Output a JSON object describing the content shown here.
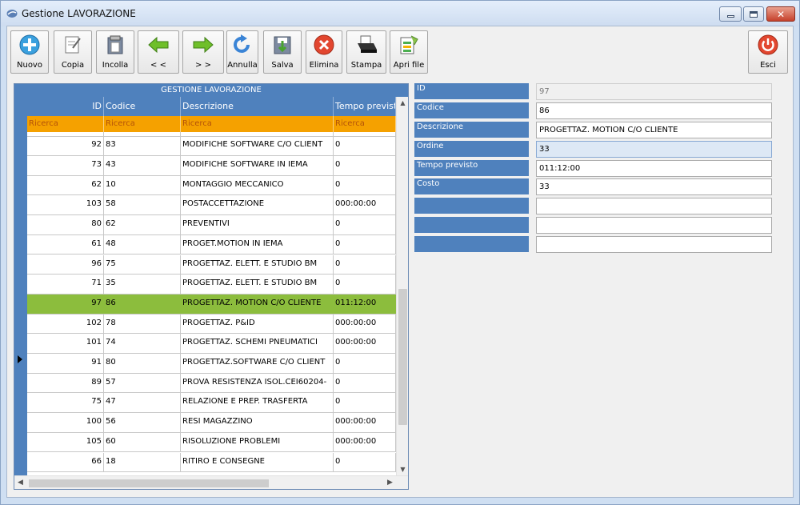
{
  "window": {
    "title": "Gestione LAVORAZIONE",
    "controls": {
      "minimize": "minimize",
      "maximize": "maximize",
      "close": "✕"
    }
  },
  "toolbar": {
    "nuovo": "Nuovo",
    "copia": "Copia",
    "incolla": "Incolla",
    "prev": "< <",
    "next": "> >",
    "annulla": "Annulla",
    "salva": "Salva",
    "elimina": "Elimina",
    "stampa": "Stampa",
    "apri_file": "Apri file",
    "esci": "Esci"
  },
  "grid": {
    "caption": "GESTIONE LAVORAZIONE",
    "columns": {
      "id": "ID",
      "codice": "Codice",
      "descrizione": "Descrizione",
      "tempo": "Tempo previsto"
    },
    "search_placeholder": "Ricerca",
    "rows": [
      {
        "id": "92",
        "codice": "83",
        "descrizione": "MODIFICHE SOFTWARE C/O CLIENT",
        "tempo": "0"
      },
      {
        "id": "73",
        "codice": "43",
        "descrizione": "MODIFICHE SOFTWARE IN IEMA",
        "tempo": "0"
      },
      {
        "id": "62",
        "codice": "10",
        "descrizione": "MONTAGGIO MECCANICO",
        "tempo": "0"
      },
      {
        "id": "103",
        "codice": "58",
        "descrizione": "POSTACCETTAZIONE",
        "tempo": "000:00:00"
      },
      {
        "id": "80",
        "codice": "62",
        "descrizione": "PREVENTIVI",
        "tempo": "0"
      },
      {
        "id": "61",
        "codice": "48",
        "descrizione": "PROGET.MOTION IN IEMA",
        "tempo": "0"
      },
      {
        "id": "96",
        "codice": "75",
        "descrizione": "PROGETTAZ. ELETT. E STUDIO BM",
        "tempo": "0"
      },
      {
        "id": "71",
        "codice": "35",
        "descrizione": "PROGETTAZ. ELETT. E STUDIO BM",
        "tempo": "0"
      },
      {
        "id": "97",
        "codice": "86",
        "descrizione": "PROGETTAZ. MOTION C/O CLIENTE",
        "tempo": "011:12:00"
      },
      {
        "id": "102",
        "codice": "78",
        "descrizione": "PROGETTAZ. P&ID",
        "tempo": "000:00:00"
      },
      {
        "id": "101",
        "codice": "74",
        "descrizione": "PROGETTAZ. SCHEMI PNEUMATICI",
        "tempo": "000:00:00"
      },
      {
        "id": "91",
        "codice": "80",
        "descrizione": "PROGETTAZ.SOFTWARE C/O CLIENT",
        "tempo": "0"
      },
      {
        "id": "89",
        "codice": "57",
        "descrizione": "PROVA RESISTENZA ISOL.CEI60204-",
        "tempo": "0"
      },
      {
        "id": "75",
        "codice": "47",
        "descrizione": "RELAZIONE E PREP. TRASFERTA",
        "tempo": "0"
      },
      {
        "id": "100",
        "codice": "56",
        "descrizione": "RESI MAGAZZINO",
        "tempo": "000:00:00"
      },
      {
        "id": "105",
        "codice": "60",
        "descrizione": "RISOLUZIONE PROBLEMI",
        "tempo": "000:00:00"
      },
      {
        "id": "66",
        "codice": "18",
        "descrizione": "RITIRO E CONSEGNE",
        "tempo": "0"
      }
    ]
  },
  "form": {
    "labels": {
      "id": "ID",
      "codice": "Codice",
      "descrizione": "Descrizione",
      "ordine": "Ordine",
      "tempo": "Tempo previsto",
      "costo": "Costo"
    },
    "values": {
      "id": "97",
      "codice": "86",
      "descrizione": "PROGETTAZ. MOTION C/O CLIENTE",
      "ordine": "33",
      "tempo": "011:12:00",
      "costo": "33"
    }
  },
  "colors": {
    "header_blue": "#4f81bd",
    "search_orange": "#f5a100",
    "selected_green": "#8cbd3d"
  }
}
